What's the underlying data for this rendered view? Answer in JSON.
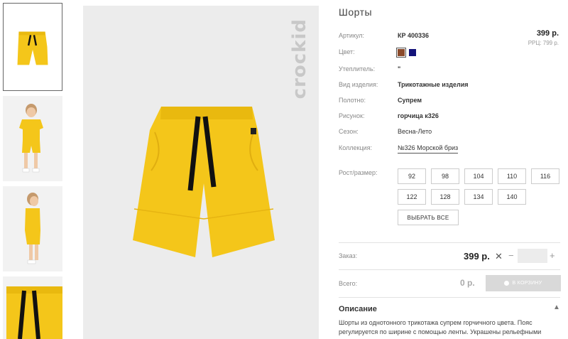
{
  "brand_logo": "crockid",
  "product": {
    "title": "Шорты",
    "price": "399 р.",
    "rrp": "РРЦ: 799 р."
  },
  "attributes": [
    {
      "label": "Артикул:",
      "value": "КР 400336"
    },
    {
      "label": "Цвет:",
      "value": ""
    },
    {
      "label": "Утеплитель:",
      "value": "\""
    },
    {
      "label": "Вид изделия:",
      "value": "Трикотажные изделия"
    },
    {
      "label": "Полотно:",
      "value": "Супрем"
    },
    {
      "label": "Рисунок:",
      "value": "горчица к326"
    },
    {
      "label": "Сезон:",
      "value": "Весна-Лето"
    },
    {
      "label": "Коллекция:",
      "value": "№326 Морской бриз"
    }
  ],
  "colors": [
    "#8b4a2b",
    "#14137a"
  ],
  "sizes_label": "Рост/размер:",
  "sizes": [
    "92",
    "98",
    "104",
    "110",
    "116",
    "122",
    "128",
    "134",
    "140"
  ],
  "select_all": "ВЫБРАТЬ ВСЕ",
  "order": {
    "label": "Заказ:",
    "price": "399 р.",
    "times": "✕",
    "minus": "−",
    "plus": "+",
    "qty": ""
  },
  "total": {
    "label": "Всего:",
    "value": "0 р.",
    "cart_button": "В КОРЗИНУ"
  },
  "description": {
    "title": "Описание",
    "text": "Шорты из однотонного трикотажа супрем горчичного цвета. Пояс регулируется по ширине с помощью ленты. Украшены рельефными"
  },
  "accent": "#f4c61a"
}
